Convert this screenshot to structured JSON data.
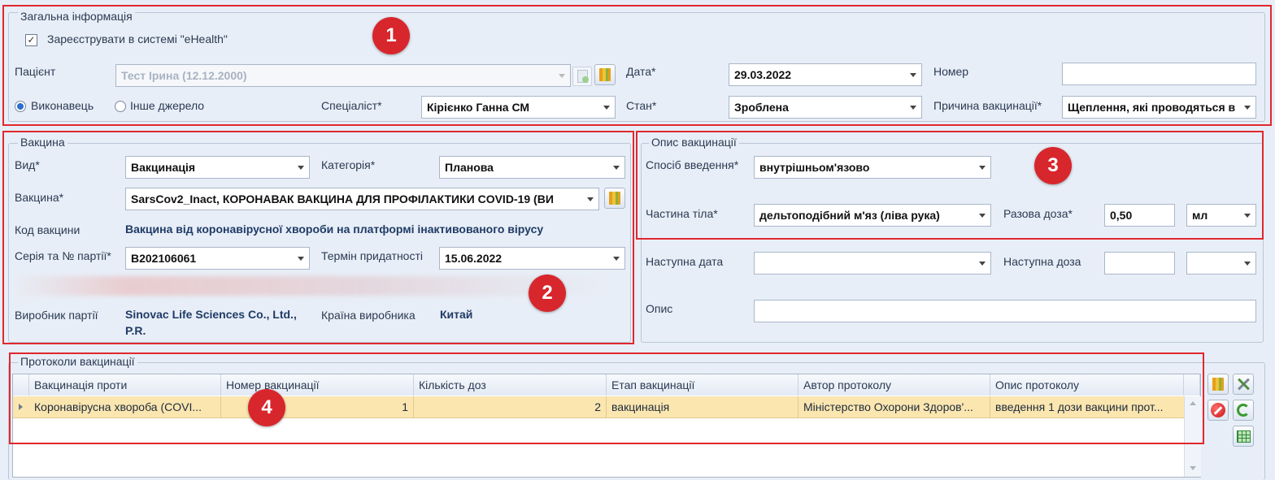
{
  "general": {
    "legend": "Загальна інформація",
    "register_label": "Зареєструвати в системі \"eHealth\"",
    "register_check": "✓",
    "patient_label": "Пацієнт",
    "patient_value": "Тест Ірина  (12.12.2000)",
    "date_label": "Дата*",
    "date_value": "29.03.2022",
    "number_label": "Номер",
    "number_value": "",
    "performer_label": "Виконавець",
    "other_source_label": "Інше джерело",
    "specialist_label": "Спеціаліст*",
    "specialist_value": "Кірієнко Ганна СМ",
    "status_label": "Стан*",
    "status_value": "Зроблена",
    "reason_label": "Причина вакцинації*",
    "reason_value": "Щеплення, які проводяться в"
  },
  "vaccine": {
    "legend": "Вакцина",
    "type_label": "Вид*",
    "type_value": "Вакцинація",
    "category_label": "Категорія*",
    "category_value": "Планова",
    "vaccine_label": "Вакцина*",
    "vaccine_value": "SarsCov2_Inact, КОРОНАВАК ВАКЦИНА ДЛЯ ПРОФІЛАКТИКИ COVID-19 (ВИ",
    "code_label": "Код вакцини",
    "code_value": "Вакцина від коронавірусної хвороби на платформі інактивованого вірусу",
    "series_label": "Серія та № партії*",
    "series_value": "B202106061",
    "expiry_label": "Термін придатності",
    "expiry_value": "15.06.2022",
    "manufacturer_label": "Виробник партії",
    "manufacturer_line1": "Sinovac Life Sciences Co., Ltd.,",
    "manufacturer_line2": "P.R.",
    "country_label": "Країна виробника",
    "country_value": "Китай"
  },
  "description": {
    "legend": "Опис вакцинації",
    "route_label": "Спосіб введення*",
    "route_value": "внутрішньом'язово",
    "body_part_label": "Частина тіла*",
    "body_part_value": "дельтоподібний м'яз (ліва рука)",
    "dose_label": "Разова доза*",
    "dose_value": "0,50",
    "unit_value": "мл",
    "next_date_label": "Наступна дата",
    "next_date_value": "",
    "next_dose_label": "Наступна доза",
    "next_dose_value": "",
    "next_unit_value": "",
    "desc_label": "Опис",
    "desc_value": ""
  },
  "protocols": {
    "legend": "Протоколи вакцинації",
    "columns": [
      "Вакцинація проти",
      "Номер вакцинації",
      "Кількість доз",
      "Етап вакцинації",
      "Автор протоколу",
      "Опис протоколу"
    ],
    "rows": [
      [
        "Коронавірусна хвороба (COVI...",
        "1",
        "2",
        "вакцинація",
        "Міністерство Охорони Здоров'...",
        "введення 1 дози вакцини прот..."
      ]
    ]
  },
  "badges": [
    "1",
    "2",
    "3",
    "4"
  ],
  "icons": [
    "checkmark-icon",
    "reference-books-icon",
    "radio-selected-icon",
    "chevron-down-icon",
    "tools-icon",
    "delete-icon",
    "refresh-link-icon",
    "spreadsheet-icon"
  ],
  "colors": {
    "highlight_box": "#e0282e",
    "badge": "#d8262d",
    "selected_row": "#fbe6b0",
    "value_text": "#1f3b66"
  }
}
